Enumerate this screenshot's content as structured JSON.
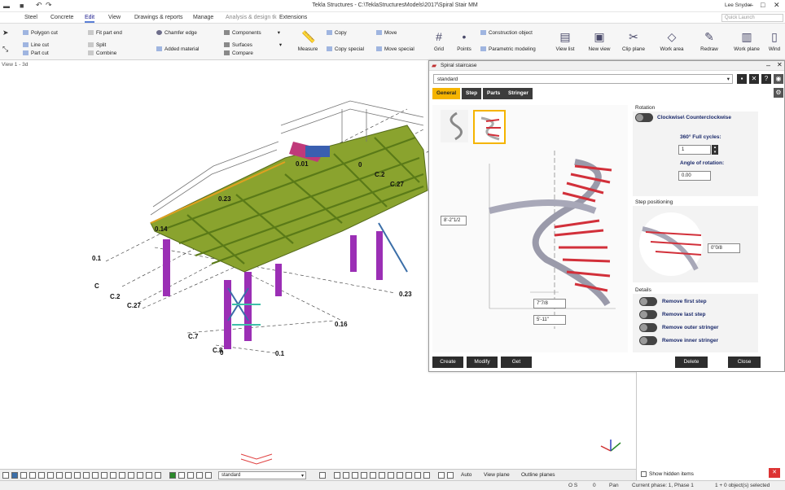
{
  "window": {
    "title": "Tekla Structures - C:\\TeklaStructuresModels\\2017\\Spiral Stair MM",
    "user": "Lee Snyder",
    "quick_launch_placeholder": "Quick Launch"
  },
  "menu_tabs": [
    "Steel",
    "Concrete",
    "Edit",
    "View",
    "Drawings & reports",
    "Manage",
    "Analysis & design tk",
    "Extensions"
  ],
  "active_menu_tab": "Edit",
  "ribbon": {
    "polygon_cut": "Polygon cut",
    "line_cut": "Line cut",
    "part_cut": "Part cut",
    "fit_part_end": "Fit part end",
    "split": "Split",
    "combine": "Combine",
    "chamfer_edge": "Chamfer edge",
    "added_material": "Added material",
    "components": "Components",
    "surfaces": "Surfaces",
    "compare": "Compare",
    "measure": "Measure",
    "copy": "Copy",
    "copy_special": "Copy special",
    "move": "Move",
    "move_special": "Move special",
    "grid": "Grid",
    "points": "Points",
    "construction_object": "Construction object",
    "parametric_modeling": "Parametric modeling",
    "view_list": "View list",
    "new_view": "New view",
    "clip_plane": "Clip plane",
    "work_area": "Work area",
    "redraw": "Redraw",
    "work_plane": "Work plane",
    "windows": "Wind"
  },
  "viewport": {
    "label": "View 1 - 3d",
    "grid_labels": [
      "0.1",
      "C",
      "C.2",
      "C.27",
      "C.7",
      "C.8",
      "0",
      "0.1",
      "0.16",
      "0.23",
      "0.23",
      "0.14",
      "0.01",
      "0",
      "C.2",
      "C.27"
    ]
  },
  "dialog": {
    "title": "Spiral staircase",
    "preset": "standard",
    "tabs": [
      "General",
      "Step",
      "Parts",
      "Stringer"
    ],
    "active_tab": "General",
    "rotation_heading": "Rotation",
    "rotation_toggle_label": "Clockwise\\ Counterclockwise",
    "full_cycles_label": "360° Full cycles:",
    "full_cycles_value": "1",
    "angle_label": "Angle of rotation:",
    "angle_value": "0.00",
    "step_positioning_heading": "Step positioning",
    "step_offset_value": "0\"0/8",
    "height_dim": "8'-2\"1/2",
    "width_dim_1": "7\"7/8",
    "width_dim_2": "5'-11\"",
    "details_heading": "Details",
    "details": [
      "Remove first step",
      "Remove last step",
      "Remove outer stringer",
      "Remove inner stringer"
    ],
    "buttons": {
      "create": "Create",
      "modify": "Modify",
      "get": "Get",
      "delete": "Delete",
      "close": "Close"
    }
  },
  "right_panel": {
    "show_hidden_items": "Show hidden items"
  },
  "bottom_toolbar": {
    "filter_select": "standard",
    "snap_mode": "Auto",
    "view_plane": "View plane",
    "outline_planes": "Outline planes"
  },
  "status": {
    "o_s": "O S",
    "zero": "0",
    "pan": "Pan",
    "phase": "Current phase: 1, Phase 1",
    "selected": "1 + 0 object(s) selected"
  },
  "colors": {
    "accent_tab": "#f5b400",
    "steel_green": "#7a9a2a",
    "column_purple": "#9b2fb5",
    "stair_red": "#d2303a"
  }
}
